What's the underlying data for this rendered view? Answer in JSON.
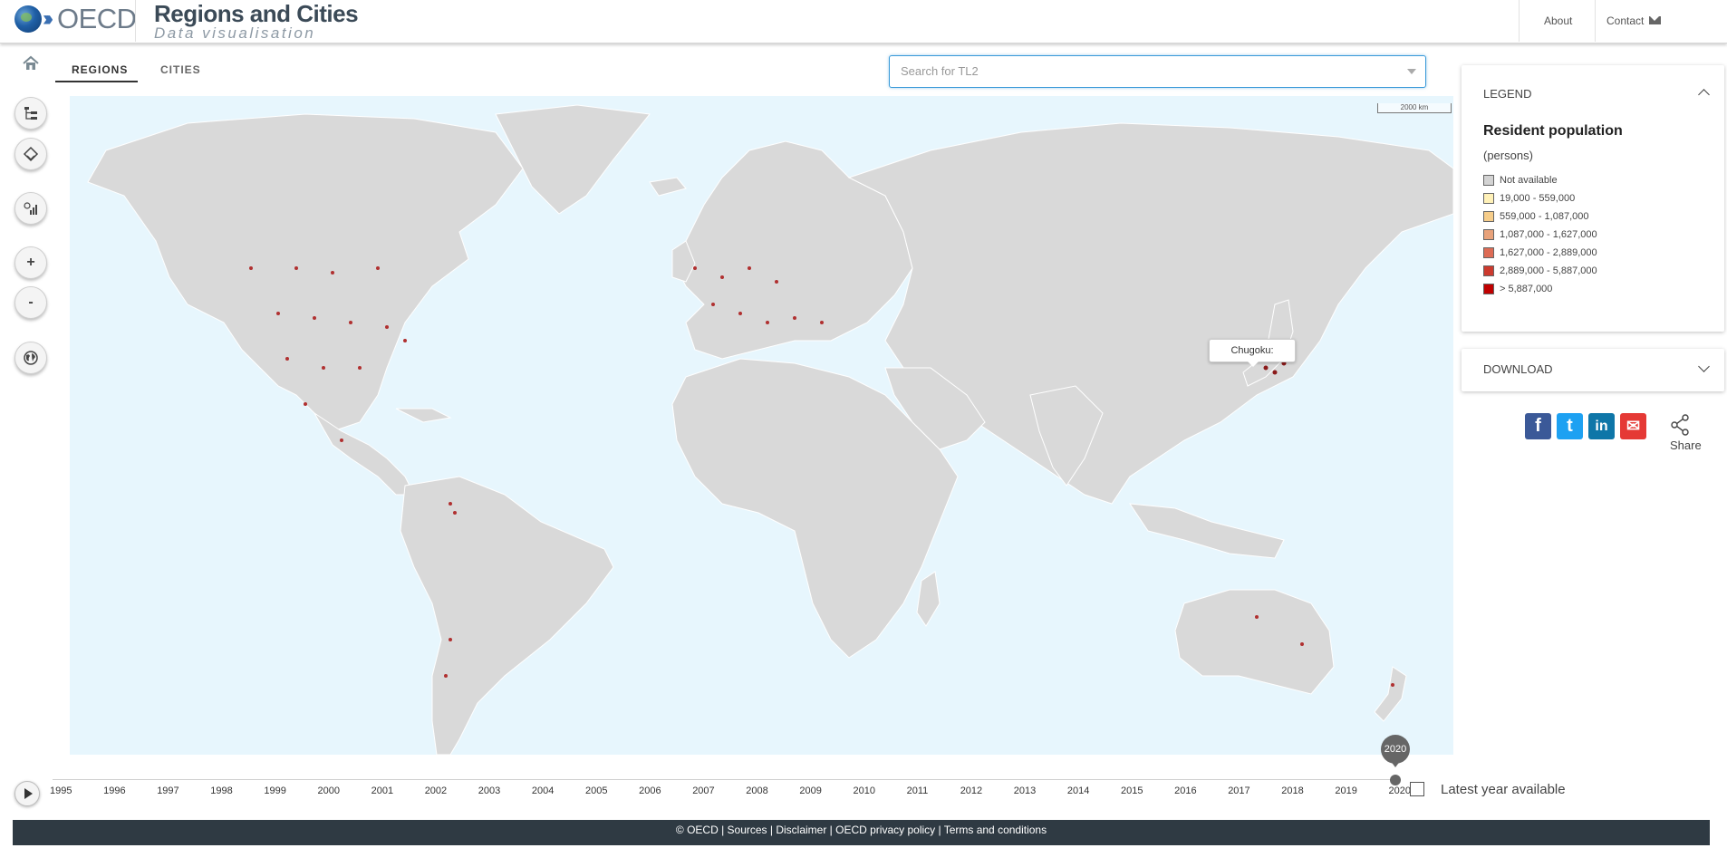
{
  "header": {
    "logo_text": "OECD",
    "app_title": "Regions and Cities",
    "app_subtitle": "Data visualisation",
    "nav": {
      "about": "About",
      "contact": "Contact"
    }
  },
  "tabs": [
    {
      "label": "REGIONS",
      "active": true
    },
    {
      "label": "CITIES",
      "active": false
    }
  ],
  "search": {
    "placeholder": "Search for TL2",
    "value": ""
  },
  "tools": [
    "tree-icon",
    "layers-icon",
    "chart-icon",
    "zoom-in-icon",
    "zoom-out-icon",
    "globe-icon"
  ],
  "map": {
    "scale_label": "2000 km",
    "tooltip": "Chugoku:"
  },
  "legend": {
    "header": "LEGEND",
    "title": "Resident population",
    "unit": "(persons)",
    "items": [
      {
        "label": "Not available",
        "color": "#d3d3d3"
      },
      {
        "label": "19,000 - 559,000",
        "color": "#fff1b8"
      },
      {
        "label": "559,000 - 1,087,000",
        "color": "#f6cd8a"
      },
      {
        "label": "1,087,000 - 1,627,000",
        "color": "#e8a27a"
      },
      {
        "label": "1,627,000 - 2,889,000",
        "color": "#dd6b55"
      },
      {
        "label": "2,889,000 - 5,887,000",
        "color": "#cc3a2e"
      },
      {
        "label": "> 5,887,000",
        "color": "#c00000"
      }
    ]
  },
  "download": {
    "header": "DOWNLOAD"
  },
  "share": {
    "label": "Share",
    "icons": [
      {
        "name": "facebook-icon",
        "color": "#3b5998",
        "glyph": "f"
      },
      {
        "name": "twitter-icon",
        "color": "#1da1f2",
        "glyph": "t"
      },
      {
        "name": "linkedin-icon",
        "color": "#0e76a8",
        "glyph": "in"
      },
      {
        "name": "email-icon",
        "color": "#e53935",
        "glyph": "✉"
      }
    ]
  },
  "timeline": {
    "years": [
      "1995",
      "1996",
      "1997",
      "1998",
      "1999",
      "2000",
      "2001",
      "2002",
      "2003",
      "2004",
      "2005",
      "2006",
      "2007",
      "2008",
      "2009",
      "2010",
      "2011",
      "2012",
      "2013",
      "2014",
      "2015",
      "2016",
      "2017",
      "2018",
      "2019",
      "2020"
    ],
    "selected": "2020",
    "latest_label": "Latest year available"
  },
  "footer": {
    "text": "© OECD | Sources | Disclaimer | OECD privacy policy | Terms and conditions"
  }
}
